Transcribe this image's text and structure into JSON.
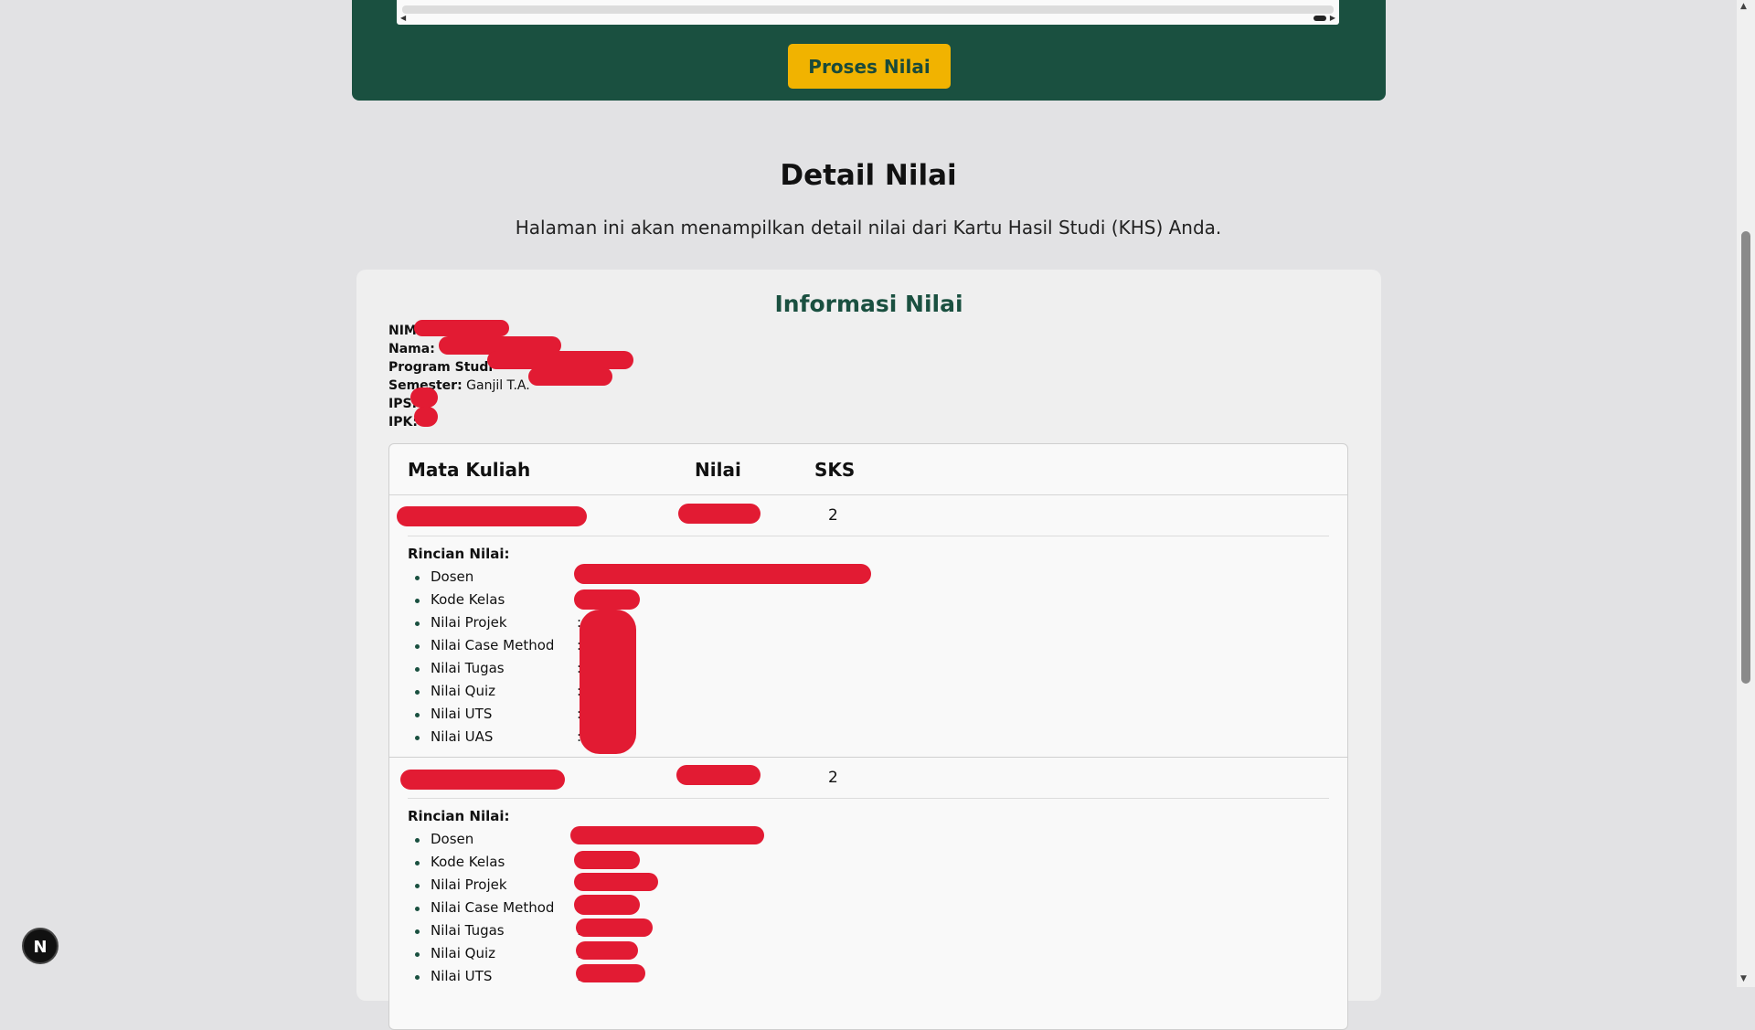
{
  "top_panel": {
    "scroll_left_icon": "chevron-left",
    "scroll_right_icon": "chevron-right",
    "process_button": "Proses Nilai"
  },
  "page": {
    "title": "Detail Nilai",
    "description": "Halaman ini akan menampilkan detail nilai dari Kartu Hasil Studi (KHS) Anda."
  },
  "card": {
    "title": "Informasi Nilai",
    "info": {
      "nim_label": "NIM",
      "nama_label": "Nama:",
      "prodi_label": "Program Studi",
      "semester_label": "Semester:",
      "semester_value": "Ganjil T.A.",
      "ips_label": "IPS:",
      "ipk_label": "IPK:"
    },
    "table": {
      "headers": {
        "course": "Mata Kuliah",
        "grade": "Nilai",
        "sks": "SKS"
      },
      "courses": [
        {
          "sks": "2",
          "rincian_title": "Rincian Nilai:",
          "details": [
            "Dosen",
            "Kode Kelas",
            "Nilai Projek",
            "Nilai Case Method",
            "Nilai Tugas",
            "Nilai Quiz",
            "Nilai UTS",
            "Nilai UAS"
          ]
        },
        {
          "sks": "2",
          "rincian_title": "Rincian Nilai:",
          "details": [
            "Dosen",
            "Kode Kelas",
            "Nilai Projek",
            "Nilai Case Method",
            "Nilai Tugas",
            "Nilai Quiz",
            "Nilai UTS"
          ]
        }
      ]
    }
  },
  "badge": {
    "letter": "N"
  },
  "colors": {
    "brand_green": "#1a5040",
    "accent_yellow": "#f1b300",
    "redaction": "#e21b33"
  }
}
